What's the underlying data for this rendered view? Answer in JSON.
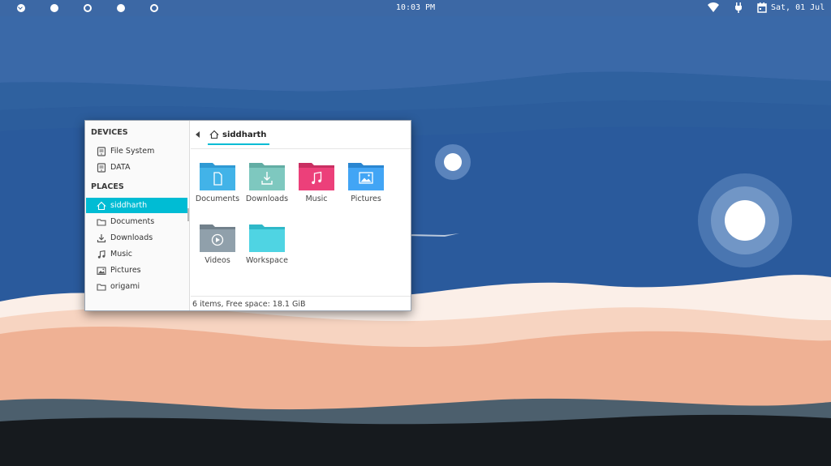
{
  "topbar": {
    "workspaces": [
      "active",
      "filled",
      "hollow",
      "filled",
      "hollow"
    ],
    "clock": "10:03 PM",
    "tray_icons": [
      "wifi-icon",
      "power-plug-icon",
      "calendar-icon"
    ],
    "date": "Sat, 01 Jul"
  },
  "sidebar": {
    "devices_header": "DEVICES",
    "devices": [
      {
        "label": "File System",
        "icon": "drive-icon"
      },
      {
        "label": "DATA",
        "icon": "drive-icon"
      }
    ],
    "places_header": "PLACES",
    "places": [
      {
        "label": "siddharth",
        "icon": "home-icon",
        "selected": true
      },
      {
        "label": "Documents",
        "icon": "folder-icon"
      },
      {
        "label": "Downloads",
        "icon": "download-icon"
      },
      {
        "label": "Music",
        "icon": "music-note-icon"
      },
      {
        "label": "Pictures",
        "icon": "image-icon"
      },
      {
        "label": "origami",
        "icon": "folder-icon"
      }
    ]
  },
  "breadcrumb": {
    "current": "siddharth",
    "icon": "home-icon"
  },
  "folders": [
    {
      "label": "Documents",
      "color": "#42b3e8",
      "icon": "document-icon"
    },
    {
      "label": "Downloads",
      "color": "#7ec8bf",
      "icon": "download-icon"
    },
    {
      "label": "Music",
      "color": "#ec407a",
      "icon": "music-note-icon"
    },
    {
      "label": "Pictures",
      "color": "#42a5f5",
      "icon": "image-icon"
    },
    {
      "label": "Videos",
      "color": "#90a0ab",
      "icon": "play-icon"
    },
    {
      "label": "Workspace",
      "color": "#4fd4e3",
      "icon": "none"
    }
  ],
  "status_text": "6 items, Free space: 18.1 GiB",
  "colors": {
    "accent": "#00bcd4",
    "topbar": "#3c68a5",
    "sky": "#2a5a9c"
  }
}
